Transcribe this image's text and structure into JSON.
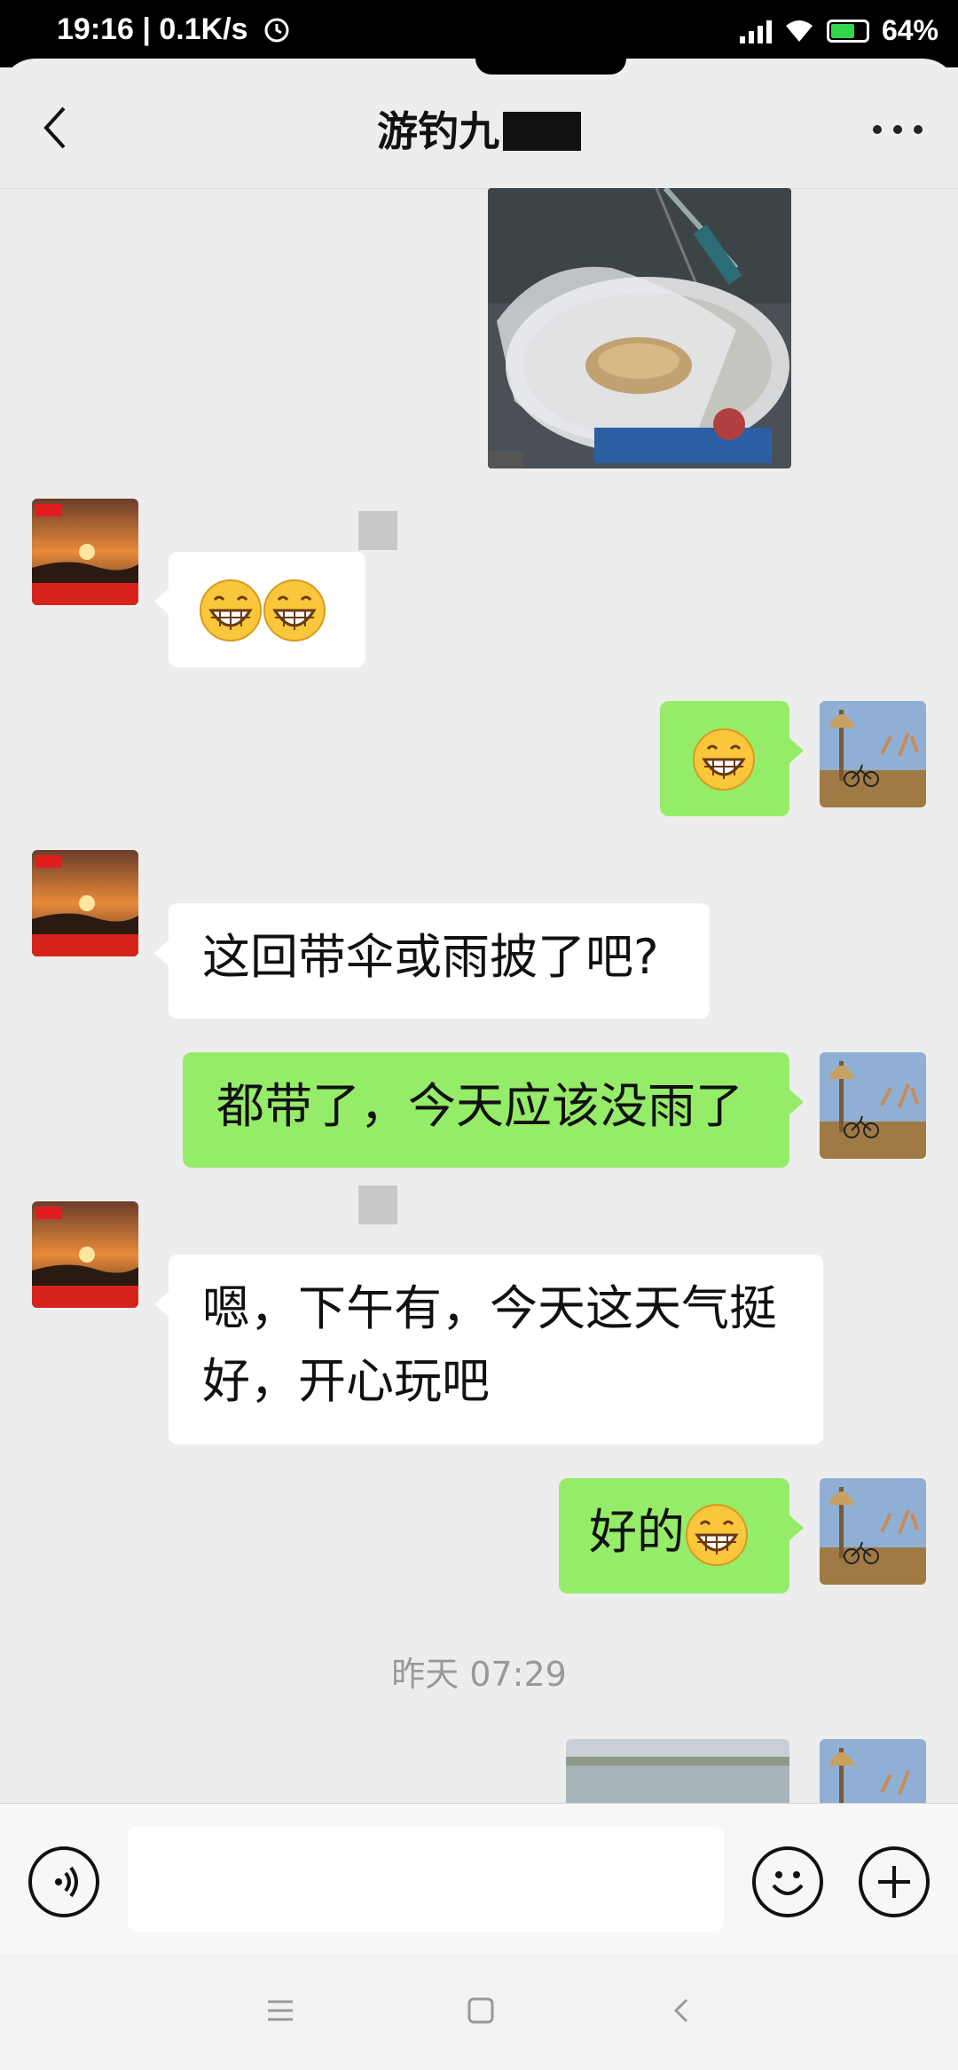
{
  "status_bar": {
    "time_speed": "19:16 | 0.1K/s",
    "battery": "64%"
  },
  "header": {
    "title": "游钓九"
  },
  "messages": {
    "m2_name": "",
    "m4_text": "这回带伞或雨披了吧?",
    "m5_text": "都带了，今天应该没雨了",
    "m6_line1": "嗯，下午有，今天这天气挺",
    "m6_line2": "好，开心玩吧",
    "m7_text": "好的"
  },
  "timestamp": "昨天 07:29",
  "icons": [
    "back-arrow-icon",
    "more-icon",
    "voice-icon",
    "emoji-icon",
    "plus-icon",
    "menu-icon",
    "home-icon",
    "back-nav-icon"
  ]
}
